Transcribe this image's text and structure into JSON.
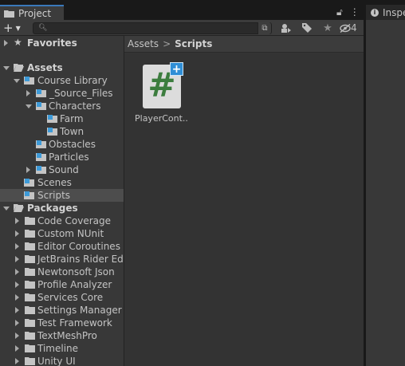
{
  "tabs": {
    "project": "Project",
    "inspector": "Inspector"
  },
  "toolbar": {
    "add_label": "+",
    "hidden_count": "4",
    "search_placeholder": ""
  },
  "breadcrumb": {
    "root": "Assets",
    "separator": ">",
    "current": "Scripts"
  },
  "tree": {
    "favorites": "Favorites",
    "assets": "Assets",
    "course_library": "Course Library",
    "source_files": "_Source_Files",
    "characters": "Characters",
    "farm": "Farm",
    "town": "Town",
    "obstacles": "Obstacles",
    "particles": "Particles",
    "sound": "Sound",
    "scenes": "Scenes",
    "scripts": "Scripts",
    "packages": "Packages",
    "pkg_code_coverage": "Code Coverage",
    "pkg_custom_nunit": "Custom NUnit",
    "pkg_editor_coroutines": "Editor Coroutines",
    "pkg_jetbrains": "JetBrains Rider Edit",
    "pkg_newtonsoft": "Newtonsoft Json",
    "pkg_profile_analyzer": "Profile Analyzer",
    "pkg_services_core": "Services Core",
    "pkg_settings_manager": "Settings Manager",
    "pkg_test_framework": "Test Framework",
    "pkg_textmeshpro": "TextMeshPro",
    "pkg_timeline": "Timeline",
    "pkg_unity_ui": "Unity UI"
  },
  "assets": [
    {
      "name": "PlayerCont...",
      "glyph": "#"
    }
  ],
  "colors": {
    "selection": "#4d4d4d",
    "accent": "#3a79bb",
    "csharp_green": "#3c7d3e",
    "plus_badge": "#2f8ed6"
  }
}
